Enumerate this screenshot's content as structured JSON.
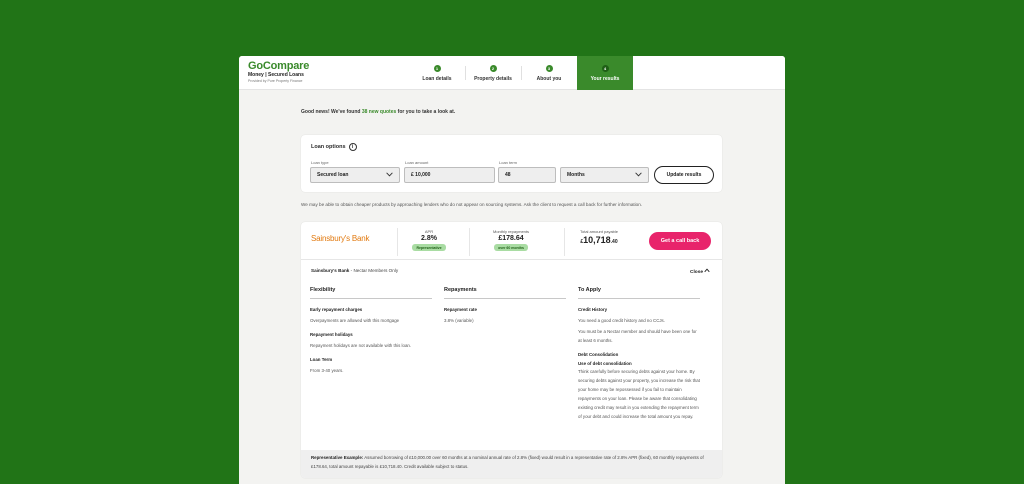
{
  "brand": {
    "name": "GoCompare",
    "product": "Money | Secured Loans",
    "provider": "Provided by Pure Property Finance"
  },
  "steps": [
    {
      "num": "1",
      "label": "Loan details"
    },
    {
      "num": "2",
      "label": "Property details"
    },
    {
      "num": "3",
      "label": "About you"
    },
    {
      "num": "4",
      "label": "Your results"
    }
  ],
  "news": {
    "prefix": "Good news! We've found",
    "count": "38 new quotes",
    "suffix": "for you to take a look at."
  },
  "loan_options": {
    "title": "Loan options",
    "info_icon": "i",
    "loan_type_label": "Loan type",
    "loan_type_value": "Secured loan",
    "loan_amount_label": "Loan amount",
    "loan_amount_value": "£  10,000",
    "loan_term_label": "Loan term",
    "loan_term_value": "48",
    "term_unit_value": "Months",
    "update_button": "Update results"
  },
  "disclaimer": "We may be able to obtain cheaper products by approaching lenders who do not appear on sourcing systems. Ask the client to request a call back for further information.",
  "offer": {
    "lender": "Sainsbury's Bank",
    "apr_label": "APR",
    "apr_value": "2.8%",
    "apr_tag": "Representative",
    "monthly_label": "Monthly repayments",
    "monthly_value": "£178.64",
    "monthly_tag": "over 60 months",
    "total_label": "Total amount payable",
    "total_currency": "£",
    "total_whole": "10,718",
    "total_pence": ".40",
    "cta": "Get a call back",
    "sub_lender": "Sainsbury's Bank",
    "sub_note": " - Nectar Members Only",
    "close_label": "Close",
    "close_icon_glyph": "^",
    "flexibility": {
      "title": "Flexibility",
      "erc_h": "Early repayment charges",
      "erc_t": "Overpayments are allowed with this mortgage",
      "hol_h": "Repayment holidays",
      "hol_t": "Repayment holidays are not available with this loan.",
      "term_h": "Loan Term",
      "term_t": "From 3-40 years."
    },
    "repayments": {
      "title": "Repayments",
      "rate_h": "Repayment rate",
      "rate_t": "3.8% (variable)"
    },
    "to_apply": {
      "title": "To Apply",
      "credit_h": "Credit History",
      "credit_t1": "You need a good credit history and no CCJs.",
      "credit_t2": "You must be a Nectar member and should have been one for at least 6 months.",
      "debt_h": "Debt Consolidation",
      "debt_sub_h": "Use of debt consolidation",
      "debt_t": "Think carefully before securing debts against your home. By securing debts against your property, you increase the risk that your home may be repossessed if you fail to maintain repayments on your loan. Please be aware that consolidating existing credit may result in you extending the repayment term of your debt and could increase the total amount you repay."
    },
    "rep_example_label": "Representative Example:",
    "rep_example_text": " Assumed borrowing of £10,000.00 over 60 months at a nominal annual rate of 2.8% (fixed) would result in a representative rate of 2.8% APR (fixed), 60 monthly repayments of £178.64, total amount repayable is £10,718.40. Credit available subject to status."
  },
  "colors": {
    "background": "#217417",
    "brand_green": "#3a8a2b",
    "cta_pink": "#e8246b",
    "lender_orange": "#e27a10"
  }
}
